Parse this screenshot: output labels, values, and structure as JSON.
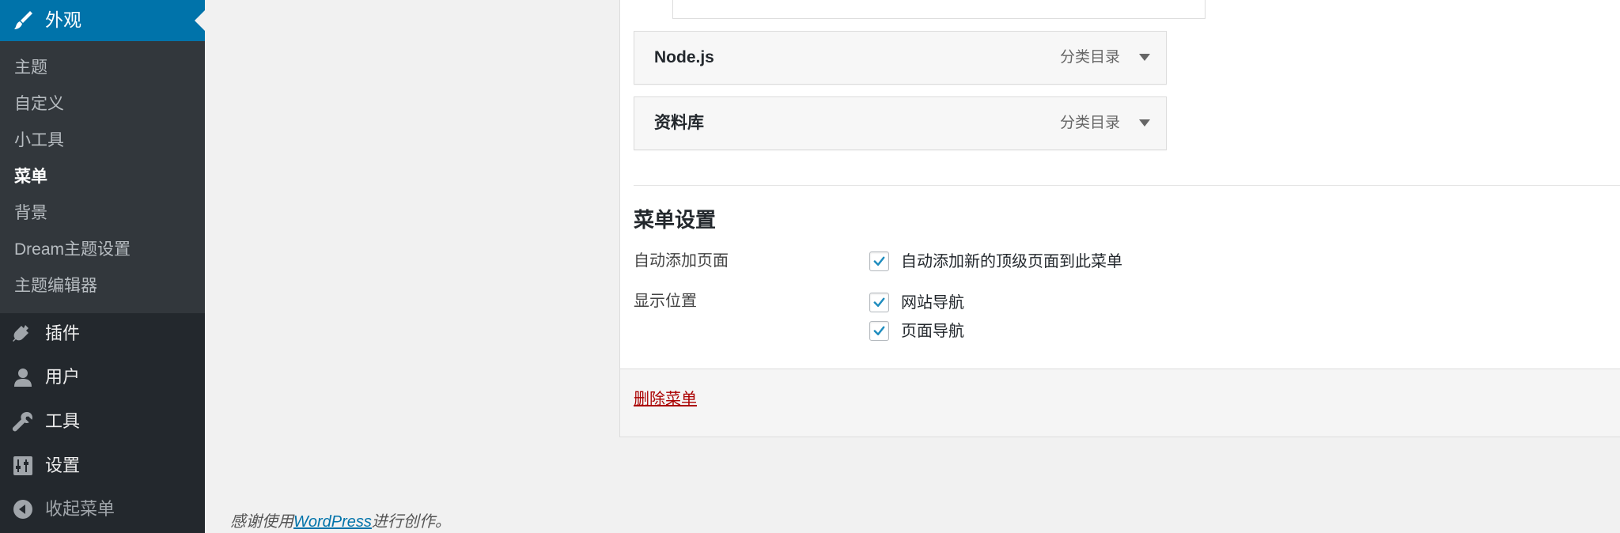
{
  "sidebar": {
    "active": {
      "label": "外观",
      "icon": "appearance-brush-icon"
    },
    "submenu": [
      {
        "label": "主题",
        "current": false
      },
      {
        "label": "自定义",
        "current": false
      },
      {
        "label": "小工具",
        "current": false
      },
      {
        "label": "菜单",
        "current": true
      },
      {
        "label": "背景",
        "current": false
      },
      {
        "label": "Dream主题设置",
        "current": false
      },
      {
        "label": "主题编辑器",
        "current": false
      }
    ],
    "items": [
      {
        "label": "插件",
        "icon": "plugin-icon"
      },
      {
        "label": "用户",
        "icon": "user-icon"
      },
      {
        "label": "工具",
        "icon": "wrench-icon"
      },
      {
        "label": "设置",
        "icon": "settings-sliders-icon"
      }
    ],
    "collapse": {
      "label": "收起菜单",
      "icon": "collapse-arrow-icon"
    }
  },
  "menu_items": [
    {
      "title": "Node.js",
      "type": "分类目录"
    },
    {
      "title": "资料库",
      "type": "分类目录"
    }
  ],
  "menu_settings": {
    "title": "菜单设置",
    "auto_add_label": "自动添加页面",
    "auto_add_option": "自动添加新的顶级页面到此菜单",
    "location_label": "显示位置",
    "locations": [
      "网站导航",
      "页面导航"
    ]
  },
  "footer": {
    "delete_label": "删除菜单"
  },
  "credit": {
    "prefix": "感谢使用",
    "link": "WordPress",
    "suffix": "进行创作。"
  },
  "colors": {
    "admin_blue": "#0073aa",
    "sidebar_bg": "#23282d",
    "submenu_bg": "#32373c",
    "delete_red": "#aa0000"
  }
}
